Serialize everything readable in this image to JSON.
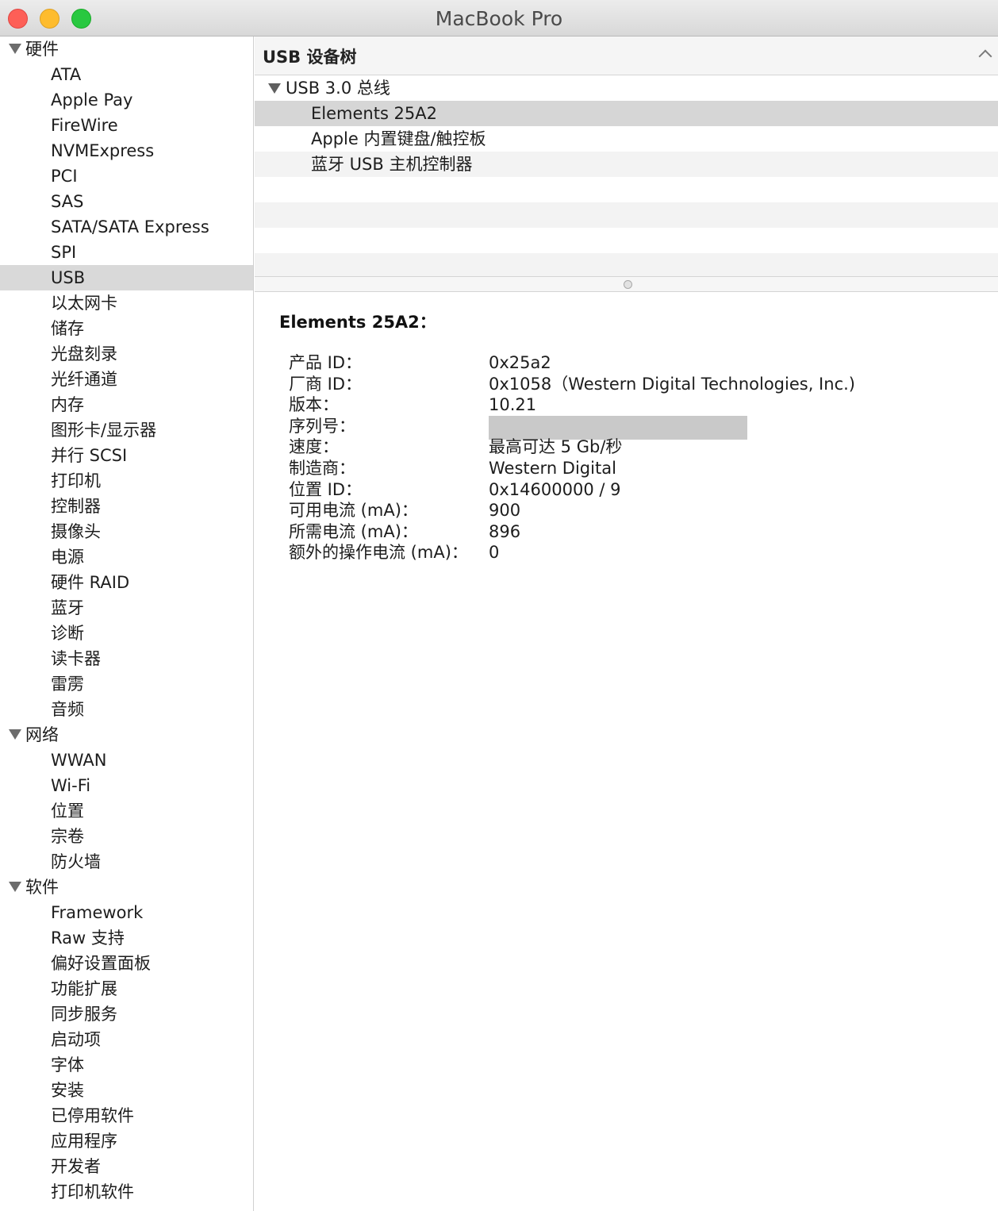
{
  "window": {
    "title": "MacBook Pro"
  },
  "sidebar": {
    "groups": [
      {
        "label": "硬件",
        "items": [
          "ATA",
          "Apple Pay",
          "FireWire",
          "NVMExpress",
          "PCI",
          "SAS",
          "SATA/SATA Express",
          "SPI",
          "USB",
          "以太网卡",
          "储存",
          "光盘刻录",
          "光纤通道",
          "内存",
          "图形卡/显示器",
          "并行 SCSI",
          "打印机",
          "控制器",
          "摄像头",
          "电源",
          "硬件 RAID",
          "蓝牙",
          "诊断",
          "读卡器",
          "雷雳",
          "音频"
        ]
      },
      {
        "label": "网络",
        "items": [
          "WWAN",
          "Wi-Fi",
          "位置",
          "宗卷",
          "防火墙"
        ]
      },
      {
        "label": "软件",
        "items": [
          "Framework",
          "Raw 支持",
          "偏好设置面板",
          "功能扩展",
          "同步服务",
          "启动项",
          "字体",
          "安装",
          "已停用软件",
          "应用程序",
          "开发者",
          "打印机软件"
        ]
      }
    ],
    "selected": "USB"
  },
  "pane": {
    "title": "USB 设备树",
    "tree": {
      "bus": "USB 3.0 总线",
      "devices": [
        "Elements 25A2",
        "Apple 内置键盘/触控板",
        "蓝牙 USB 主机控制器"
      ],
      "selected": "Elements 25A2"
    }
  },
  "details": {
    "heading": "Elements 25A2：",
    "rows": [
      {
        "key": "产品 ID：",
        "value": "0x25a2"
      },
      {
        "key": "厂商 ID：",
        "value": "0x1058（Western Digital Technologies, Inc.)"
      },
      {
        "key": "版本：",
        "value": "10.21"
      },
      {
        "key": "序列号：",
        "value": ""
      },
      {
        "key": "速度：",
        "value": "最高可达 5 Gb/秒"
      },
      {
        "key": "制造商：",
        "value": "Western Digital"
      },
      {
        "key": "位置 ID：",
        "value": "0x14600000 / 9"
      },
      {
        "key": "可用电流 (mA)：",
        "value": "900"
      },
      {
        "key": "所需电流 (mA)：",
        "value": "896"
      },
      {
        "key": "额外的操作电流 (mA)：",
        "value": "0"
      }
    ]
  },
  "colors": {
    "selection": "#d9d9d9",
    "close": "#fd5f57",
    "minimize": "#febc2e",
    "zoom": "#28c840"
  }
}
